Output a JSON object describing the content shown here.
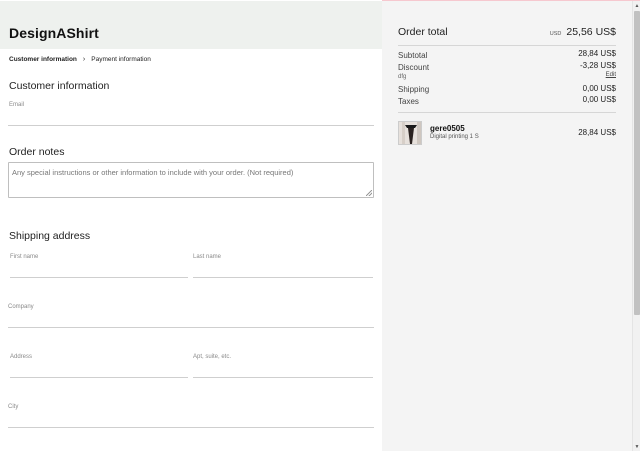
{
  "brand": "DesignAShirt",
  "breadcrumb": {
    "step1": "Customer information",
    "separator": "›",
    "step2": "Payment information"
  },
  "customer_info": {
    "heading": "Customer information",
    "email_label": "Email",
    "email_value": ""
  },
  "order_notes": {
    "heading": "Order notes",
    "placeholder": "Any special instructions or other information to include with your order. (Not required)"
  },
  "shipping": {
    "heading": "Shipping address",
    "first_name_label": "First name",
    "last_name_label": "Last name",
    "company_label": "Company",
    "address_label": "Address",
    "apt_label": "Apt, suite, etc.",
    "city_label": "City"
  },
  "summary": {
    "title": "Order total",
    "currency": "USD",
    "total": "25,56 US$",
    "subtotal_label": "Subtotal",
    "subtotal": "28,84 US$",
    "discount_label": "Discount",
    "discount": "-3,28 US$",
    "discount_code": "dfg",
    "edit_label": "Edit",
    "shipping_label": "Shipping",
    "shipping": "0,00 US$",
    "taxes_label": "Taxes",
    "taxes": "0,00 US$"
  },
  "product": {
    "name": "gere0505",
    "variant": "Digital printing  1 S",
    "price": "28,84 US$"
  },
  "icons": {
    "scroll_up": "scroll-up-arrow-icon",
    "scroll_down": "scroll-down-arrow-icon",
    "resize": "textarea-resize-grip-icon"
  },
  "colors": {
    "brand_bar": "#eef1ee",
    "summary_bg": "#f4f4f4",
    "accent_line": "#f6c8cf"
  }
}
